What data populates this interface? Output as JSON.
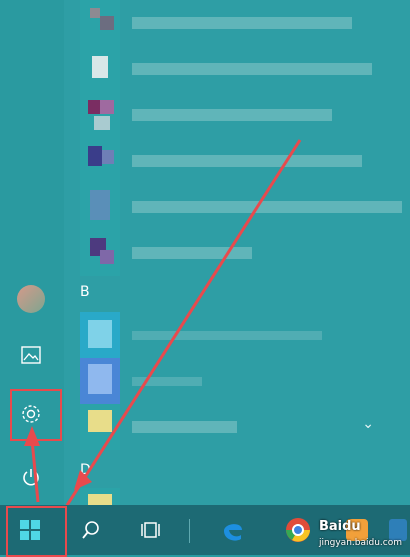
{
  "start_menu": {
    "section_b": "B",
    "section_d": "D",
    "scroll_letter": "^"
  },
  "taskbar": {
    "start_label": "Start",
    "search_label": "Search",
    "taskview_label": "Task View",
    "edge_label": "Edge",
    "browser_label": "Browser",
    "watermark_text": "Baidu",
    "watermark_sub": "jingyan.baidu.com"
  },
  "colors": {
    "accent": "#2a9aa0",
    "taskbar": "#1d6a74",
    "highlight": "#e84a4d"
  },
  "icons": [
    "user-avatar-icon",
    "pictures-icon",
    "settings-gear-icon",
    "power-icon",
    "windows-logo-icon",
    "search-icon",
    "task-view-icon",
    "edge-icon",
    "chrome-icon"
  ]
}
